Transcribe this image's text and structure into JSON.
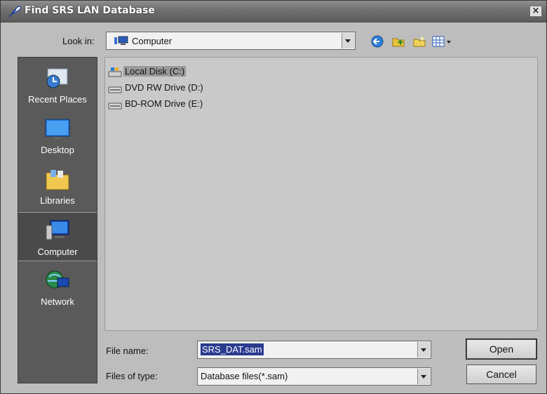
{
  "window": {
    "title": "Find SRS LAN Database",
    "close_label": "×"
  },
  "lookin": {
    "label": "Look in:",
    "value": "Computer"
  },
  "toolbar": {
    "back_icon": "back-arrow-icon",
    "up_icon": "up-folder-icon",
    "new_folder_icon": "new-folder-icon",
    "views_icon": "views-menu-icon"
  },
  "places": [
    {
      "label": "Recent Places",
      "icon": "recent-places-icon"
    },
    {
      "label": "Desktop",
      "icon": "desktop-icon"
    },
    {
      "label": "Libraries",
      "icon": "libraries-icon"
    },
    {
      "label": "Computer",
      "icon": "computer-icon"
    },
    {
      "label": "Network",
      "icon": "network-icon"
    }
  ],
  "items": [
    {
      "label": "Local Disk (C:)",
      "icon": "local-disk-icon"
    },
    {
      "label": "DVD RW Drive (D:)",
      "icon": "dvd-drive-icon"
    },
    {
      "label": "BD-ROM Drive (E:)",
      "icon": "bd-drive-icon"
    }
  ],
  "filename": {
    "label": "File name:",
    "value": "SRS_DAT.sam"
  },
  "filetype": {
    "label": "Files of type:",
    "value": "Database files(*.sam)"
  },
  "buttons": {
    "open": "Open",
    "cancel": "Cancel"
  }
}
